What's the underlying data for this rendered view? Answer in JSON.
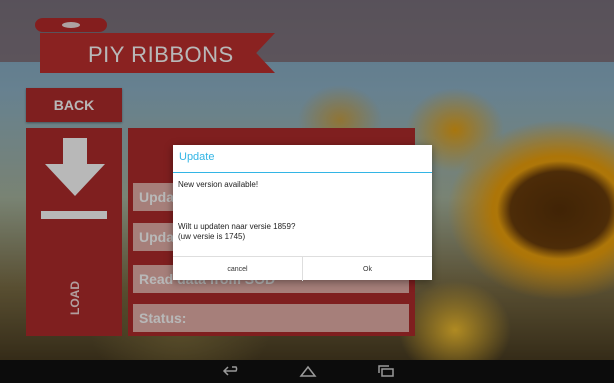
{
  "app": {
    "title": "PIY RIBBONS",
    "back_label": "BACK",
    "load_label": "LOAD"
  },
  "panel": {
    "rows": [
      {
        "label": "Upda"
      },
      {
        "label": "Upda"
      },
      {
        "label": "Read data from SOD"
      },
      {
        "label": "Status:"
      }
    ]
  },
  "dialog": {
    "title": "Update",
    "message1": "New version available!",
    "message2": "Wilt u updaten naar versie 1859?",
    "message3": "(uw versie is 1745)",
    "cancel_label": "cancel",
    "ok_label": "Ok"
  },
  "nav": {
    "icons": [
      "back-icon",
      "home-icon",
      "recents-icon"
    ]
  },
  "colors": {
    "brand_red": "#b12c2c",
    "dialog_accent": "#33b5e5",
    "row_bg": "#e6b1a9"
  }
}
